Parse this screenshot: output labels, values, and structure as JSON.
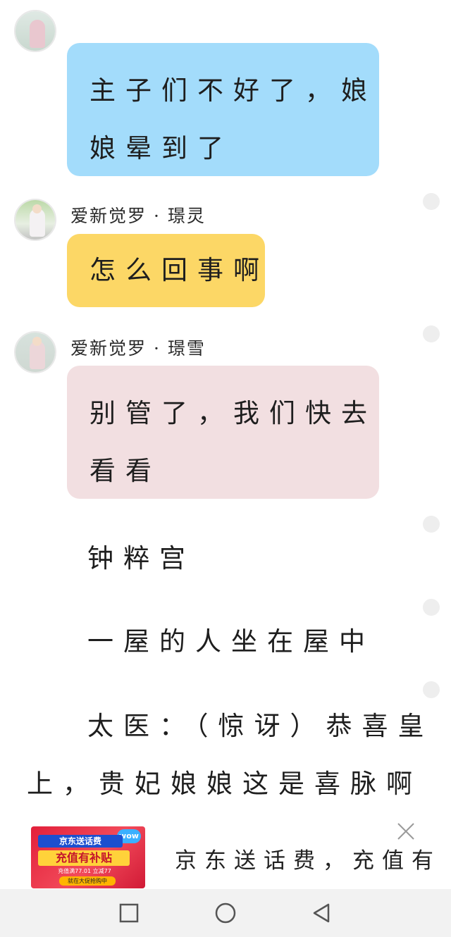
{
  "messages": [
    {
      "lines": [
        "主子们不好了，娘",
        "娘晕到了"
      ],
      "color": "#a3dcfb"
    },
    {
      "sender": "爱新觉罗 · 璟灵",
      "lines": [
        "怎么回事啊"
      ],
      "color": "#fcd766"
    },
    {
      "sender": "爱新觉罗 · 璟雪",
      "lines": [
        "别管了，我们快去",
        "看看"
      ],
      "color": "#f2dfe1"
    }
  ],
  "narration": [
    "钟粹宫",
    "一屋的人坐在屋中",
    "太医：（惊讶）恭喜皇",
    "上，贵妃娘娘这是喜脉啊"
  ],
  "ad": {
    "banner_line1": "京东送话费",
    "banner_line2": "充值有补贴",
    "banner_line3": "充值满77.01 立减77",
    "banner_line4": "就在大促抢购中",
    "banner_badge": "wow",
    "text": "京东送话费，充值有补贴"
  },
  "icons": {
    "close": "close-icon",
    "nav_recent": "square-icon",
    "nav_home": "circle-icon",
    "nav_back": "triangle-back-icon"
  }
}
